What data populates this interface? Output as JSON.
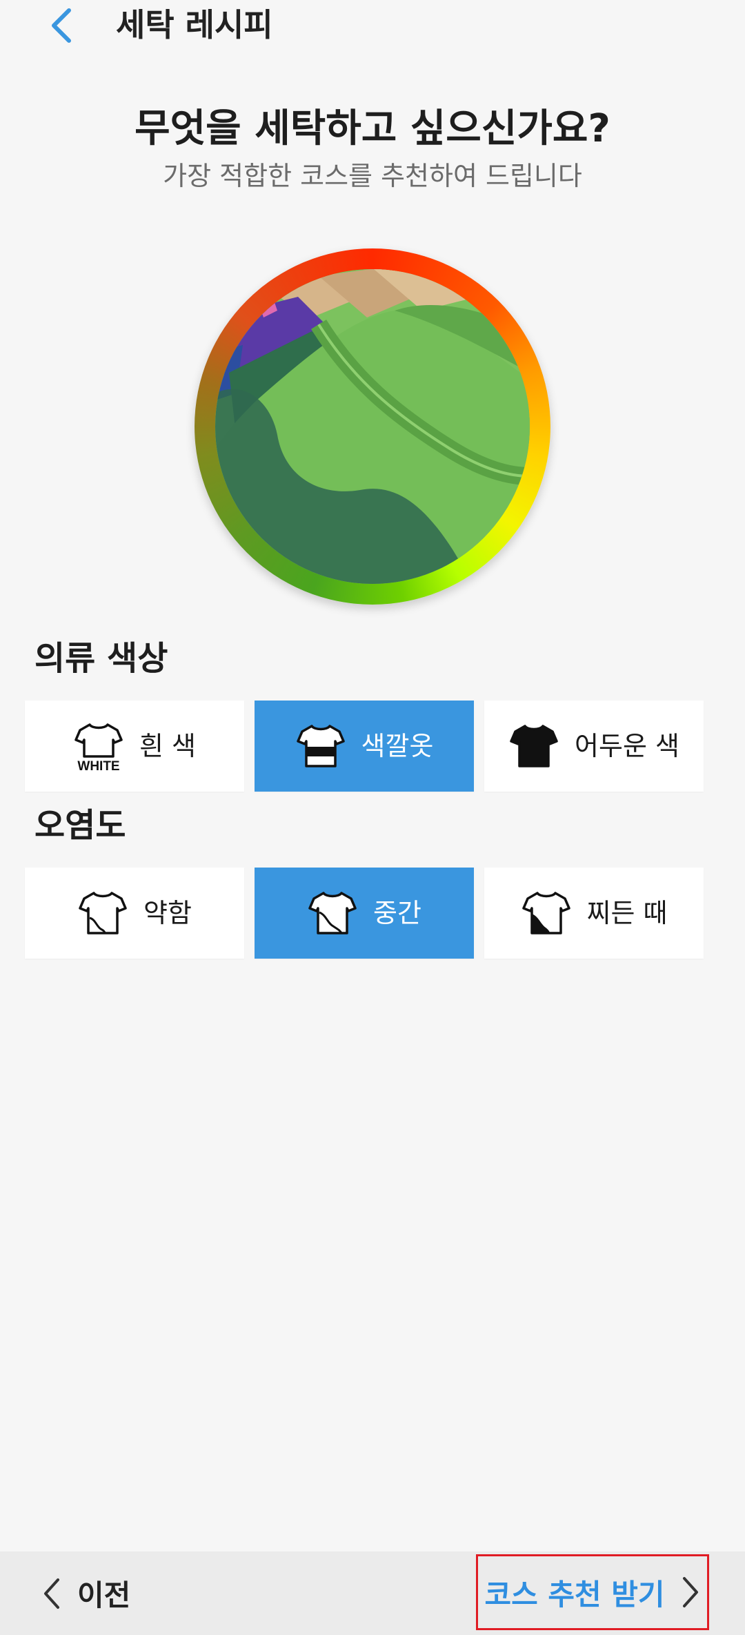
{
  "app": {
    "title": "세탁 레시피"
  },
  "header": {
    "question": "무엇을 세탁하고 싶으신가요?",
    "subtitle": "가장 적합한 코스를 추천하여 드립니다"
  },
  "color_section": {
    "title": "의류 색상",
    "options": [
      {
        "label": "흰 색",
        "icon_text": "WHITE",
        "selected": false
      },
      {
        "label": "색깔옷",
        "selected": true
      },
      {
        "label": "어두운 색",
        "selected": false
      }
    ]
  },
  "soil_section": {
    "title": "오염도",
    "options": [
      {
        "label": "약함",
        "selected": false
      },
      {
        "label": "중간",
        "selected": true
      },
      {
        "label": "찌든 때",
        "selected": false
      }
    ]
  },
  "footer": {
    "prev_label": "이전",
    "next_label": "코스 추천 받기"
  },
  "colors": {
    "accent": "#3a96df",
    "highlight_border": "#e01c24",
    "next_text": "#2f8ee0"
  }
}
